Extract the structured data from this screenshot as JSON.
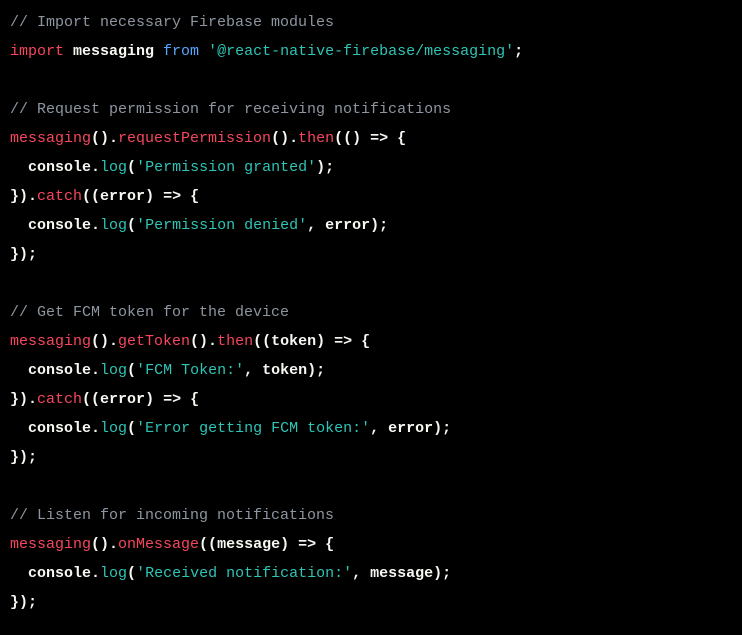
{
  "code": {
    "l1_comment": "// Import necessary Firebase modules",
    "l2_import": "import",
    "l2_messaging": " messaging ",
    "l2_from": "from",
    "l2_space": " ",
    "l2_str": "'@react-native-firebase/messaging'",
    "l2_semi": ";",
    "l4_comment": "// Request permission for receiving notifications",
    "l5a": "messaging",
    "l5b": "().",
    "l5c": "requestPermission",
    "l5d": "().",
    "l5e": "then",
    "l5f": "(() => {",
    "l6a": "  console",
    "l6b": ".",
    "l6c": "log",
    "l6d": "(",
    "l6e": "'Permission granted'",
    "l6f": ");",
    "l7a": "}).",
    "l7b": "catch",
    "l7c": "((",
    "l7d": "error",
    "l7e": ") => {",
    "l8a": "  console",
    "l8b": ".",
    "l8c": "log",
    "l8d": "(",
    "l8e": "'Permission denied'",
    "l8f": ", ",
    "l8g": "error",
    "l8h": ");",
    "l9": "});",
    "l11_comment": "// Get FCM token for the device",
    "l12a": "messaging",
    "l12b": "().",
    "l12c": "getToken",
    "l12d": "().",
    "l12e": "then",
    "l12f": "((",
    "l12g": "token",
    "l12h": ") => {",
    "l13a": "  console",
    "l13b": ".",
    "l13c": "log",
    "l13d": "(",
    "l13e": "'FCM Token:'",
    "l13f": ", ",
    "l13g": "token",
    "l13h": ");",
    "l14a": "}).",
    "l14b": "catch",
    "l14c": "((",
    "l14d": "error",
    "l14e": ") => {",
    "l15a": "  console",
    "l15b": ".",
    "l15c": "log",
    "l15d": "(",
    "l15e": "'Error getting FCM token:'",
    "l15f": ", ",
    "l15g": "error",
    "l15h": ");",
    "l16": "});",
    "l18_comment": "// Listen for incoming notifications",
    "l19a": "messaging",
    "l19b": "().",
    "l19c": "onMessage",
    "l19d": "((",
    "l19e": "message",
    "l19f": ") => {",
    "l20a": "  console",
    "l20b": ".",
    "l20c": "log",
    "l20d": "(",
    "l20e": "'Received notification:'",
    "l20f": ", ",
    "l20g": "message",
    "l20h": ");",
    "l21": "});"
  }
}
